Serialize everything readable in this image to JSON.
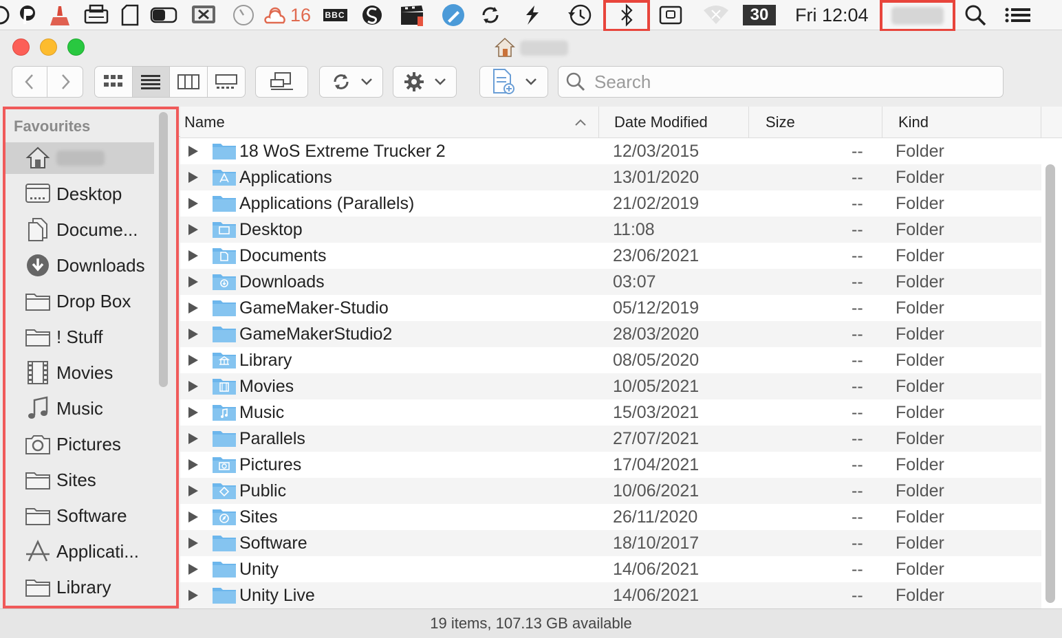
{
  "menubar": {
    "weather_temp": "16",
    "bbc_label": "BBC",
    "calendar_day": "30",
    "clock": "Fri 12:04",
    "icons": [
      "edge-icon",
      "p-icon",
      "broom-icon",
      "scanner-icon",
      "document-icon",
      "toggle-icon",
      "screen-x-icon",
      "dial-icon",
      "weather-icon",
      "bbc-icon",
      "s-icon",
      "clapper-icon",
      "blue-pen-icon",
      "sync-icon",
      "gesture-icon",
      "time-machine-icon",
      "bluetooth-icon",
      "keyboard-icon",
      "wifi-icon",
      "calendar-icon",
      "clock",
      "user-name",
      "spotlight-icon",
      "list-icon"
    ]
  },
  "window": {
    "title_icon": "home-icon"
  },
  "toolbar": {
    "search_placeholder": "Search",
    "view_modes": [
      "icons",
      "list",
      "columns",
      "gallery"
    ],
    "active_view": "list"
  },
  "sidebar": {
    "header": "Favourites",
    "items": [
      {
        "label": "",
        "icon": "home-icon",
        "selected": true
      },
      {
        "label": "Desktop",
        "icon": "desktop-icon"
      },
      {
        "label": "Docume...",
        "icon": "documents-icon"
      },
      {
        "label": "Downloads",
        "icon": "downloads-icon"
      },
      {
        "label": "Drop Box",
        "icon": "folder-icon"
      },
      {
        "label": "! Stuff",
        "icon": "folder-icon"
      },
      {
        "label": "Movies",
        "icon": "movies-icon"
      },
      {
        "label": "Music",
        "icon": "music-icon"
      },
      {
        "label": "Pictures",
        "icon": "camera-icon"
      },
      {
        "label": "Sites",
        "icon": "folder-icon"
      },
      {
        "label": "Software",
        "icon": "folder-icon"
      },
      {
        "label": "Applicati...",
        "icon": "applications-icon"
      },
      {
        "label": "Library",
        "icon": "folder-icon"
      }
    ]
  },
  "list": {
    "columns": {
      "name": "Name",
      "date": "Date Modified",
      "size": "Size",
      "kind": "Kind"
    },
    "rows": [
      {
        "name": "18 WoS Extreme Trucker 2",
        "date": "12/03/2015",
        "size": "--",
        "kind": "Folder",
        "glyph": ""
      },
      {
        "name": "Applications",
        "date": "13/01/2020",
        "size": "--",
        "kind": "Folder",
        "glyph": "A"
      },
      {
        "name": "Applications (Parallels)",
        "date": "21/02/2019",
        "size": "--",
        "kind": "Folder",
        "glyph": ""
      },
      {
        "name": "Desktop",
        "date": "11:08",
        "size": "--",
        "kind": "Folder",
        "glyph": "desk"
      },
      {
        "name": "Documents",
        "date": "23/06/2021",
        "size": "--",
        "kind": "Folder",
        "glyph": "doc"
      },
      {
        "name": "Downloads",
        "date": "03:07",
        "size": "--",
        "kind": "Folder",
        "glyph": "down"
      },
      {
        "name": "GameMaker-Studio",
        "date": "05/12/2019",
        "size": "--",
        "kind": "Folder",
        "glyph": ""
      },
      {
        "name": "GameMakerStudio2",
        "date": "28/03/2020",
        "size": "--",
        "kind": "Folder",
        "glyph": ""
      },
      {
        "name": "Library",
        "date": "08/05/2020",
        "size": "--",
        "kind": "Folder",
        "glyph": "lib"
      },
      {
        "name": "Movies",
        "date": "10/05/2021",
        "size": "--",
        "kind": "Folder",
        "glyph": "film"
      },
      {
        "name": "Music",
        "date": "15/03/2021",
        "size": "--",
        "kind": "Folder",
        "glyph": "note"
      },
      {
        "name": "Parallels",
        "date": "27/07/2021",
        "size": "--",
        "kind": "Folder",
        "glyph": ""
      },
      {
        "name": "Pictures",
        "date": "17/04/2021",
        "size": "--",
        "kind": "Folder",
        "glyph": "cam"
      },
      {
        "name": "Public",
        "date": "10/06/2021",
        "size": "--",
        "kind": "Folder",
        "glyph": "pub"
      },
      {
        "name": "Sites",
        "date": "26/11/2020",
        "size": "--",
        "kind": "Folder",
        "glyph": "compass"
      },
      {
        "name": "Software",
        "date": "18/10/2017",
        "size": "--",
        "kind": "Folder",
        "glyph": ""
      },
      {
        "name": "Unity",
        "date": "14/06/2021",
        "size": "--",
        "kind": "Folder",
        "glyph": ""
      },
      {
        "name": "Unity Live",
        "date": "14/06/2021",
        "size": "--",
        "kind": "Folder",
        "glyph": ""
      }
    ]
  },
  "statusbar": {
    "text": "19 items, 107.13 GB available"
  },
  "colors": {
    "highlight": "#e8453c",
    "folder": "#6cb6ec",
    "selection": "#d0d0d0"
  }
}
